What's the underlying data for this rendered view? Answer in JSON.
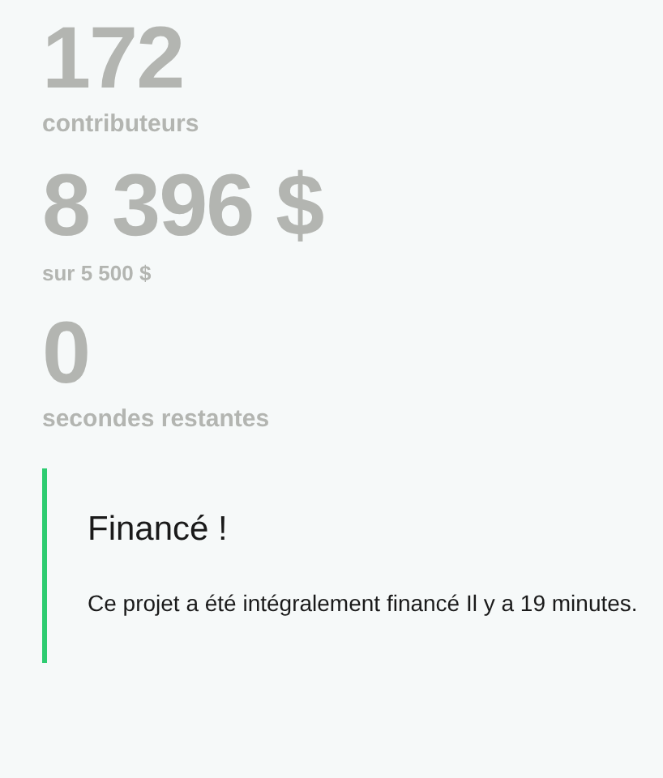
{
  "stats": [
    {
      "kind": "count",
      "value": "172",
      "label": "contributeurs"
    },
    {
      "kind": "amount",
      "value": "8 396 $",
      "label": "sur 5 500 $"
    },
    {
      "kind": "count",
      "value": "0",
      "label": "secondes restantes"
    }
  ],
  "notice": {
    "title": "Financé !",
    "text": "Ce projet a été intégralement financé Il y a 19 minutes."
  }
}
